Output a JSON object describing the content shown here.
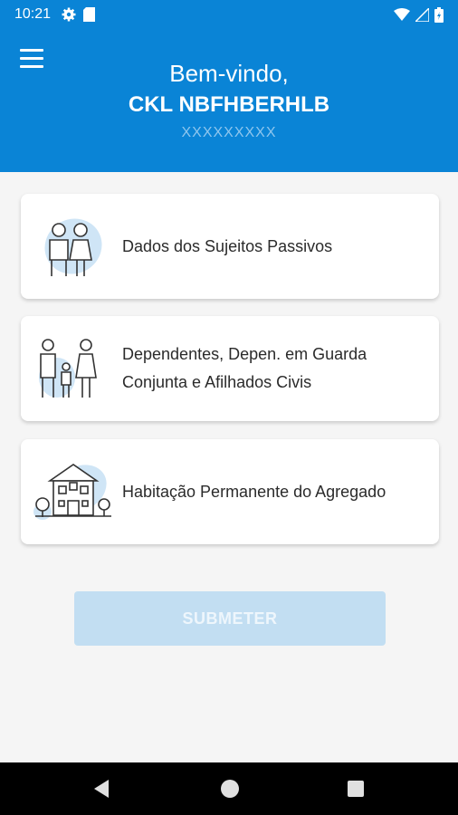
{
  "status_bar": {
    "time": "10:21",
    "left_icons": [
      "gear-icon",
      "sd-card-icon"
    ],
    "right_icons": [
      "wifi-icon",
      "signal-icon",
      "battery-icon"
    ]
  },
  "header": {
    "welcome": "Bem-vindo,",
    "user_name": "CKL NBFHBERHLB",
    "user_id": "XXXXXXXXX",
    "background_color": "#0a84d6"
  },
  "cards": [
    {
      "label": "Dados dos Sujeitos Passivos",
      "icon": "couple-icon"
    },
    {
      "label_line1": "Dependentes, Depen. em Guarda",
      "label_line2": "Conjunta e Afilhados Civis",
      "icon": "family-icon"
    },
    {
      "label": "Habitação Permanente do Agregado",
      "icon": "house-icon"
    }
  ],
  "submit": {
    "label": "SUBMETER",
    "state": "disabled"
  },
  "nav_bar": {
    "buttons": [
      "back-icon",
      "home-icon",
      "recent-apps-icon"
    ]
  }
}
